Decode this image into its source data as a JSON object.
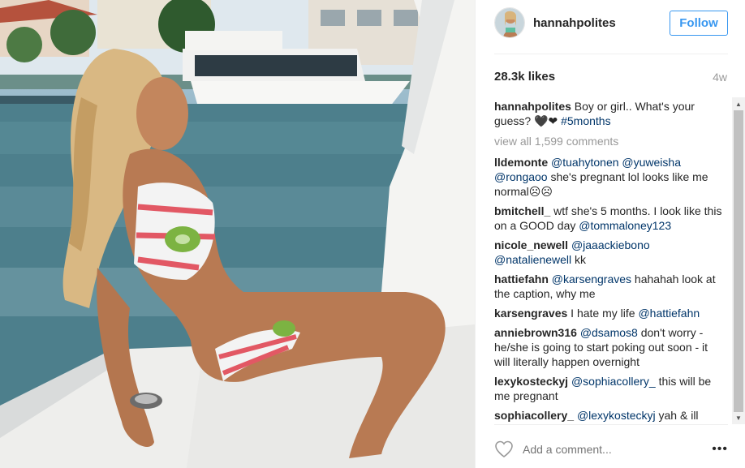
{
  "post": {
    "username": "hannahpolites",
    "follow_label": "Follow",
    "likes": "28.3k likes",
    "age": "4w",
    "view_all": "view all 1,599 comments",
    "add_comment_placeholder": "Add a comment...",
    "more_icon": "•••"
  },
  "caption": {
    "user": "hannahpolites",
    "text": " Boy or girl.. What's your guess? ",
    "emoji": "🖤❤",
    "tag": "#5months"
  },
  "comments": [
    {
      "user": "lldemonte",
      "parts": [
        {
          "t": " ",
          "m": false
        },
        {
          "t": "@tuahytonen",
          "m": true
        },
        {
          "t": " ",
          "m": false
        },
        {
          "t": "@yuweisha",
          "m": true
        },
        {
          "t": " ",
          "m": false
        },
        {
          "t": "@rongaoo",
          "m": true
        },
        {
          "t": " she's pregnant lol looks like me normal☹☹",
          "m": false
        }
      ]
    },
    {
      "user": "bmitchell_",
      "parts": [
        {
          "t": " wtf she's 5 months. I look like this on a GOOD day ",
          "m": false
        },
        {
          "t": "@tommaloney123",
          "m": true
        }
      ]
    },
    {
      "user": "nicole_newell",
      "parts": [
        {
          "t": " ",
          "m": false
        },
        {
          "t": "@jaaackiebono",
          "m": true
        },
        {
          "t": " ",
          "m": false
        },
        {
          "t": "@natalienewell",
          "m": true
        },
        {
          "t": " kk",
          "m": false
        }
      ]
    },
    {
      "user": "hattiefahn",
      "parts": [
        {
          "t": " ",
          "m": false
        },
        {
          "t": "@karsengraves",
          "m": true
        },
        {
          "t": " hahahah look at the caption, why me",
          "m": false
        }
      ]
    },
    {
      "user": "karsengraves",
      "parts": [
        {
          "t": " I hate my life ",
          "m": false
        },
        {
          "t": "@hattiefahn",
          "m": true
        }
      ]
    },
    {
      "user": "anniebrown316",
      "parts": [
        {
          "t": " ",
          "m": false
        },
        {
          "t": "@dsamos8",
          "m": true
        },
        {
          "t": " don't worry - he/she is going to start poking out soon - it will literally happen overnight",
          "m": false
        }
      ]
    },
    {
      "user": "lexykosteckyj",
      "parts": [
        {
          "t": " ",
          "m": false
        },
        {
          "t": "@sophiacollery_",
          "m": true
        },
        {
          "t": " this will be me pregnant",
          "m": false
        }
      ]
    },
    {
      "user": "sophiacollery_",
      "parts": [
        {
          "t": " ",
          "m": false
        },
        {
          "t": "@lexykosteckyj",
          "m": true
        },
        {
          "t": " yah & ill",
          "m": false
        }
      ]
    }
  ],
  "colors": {
    "accent": "#3897f0",
    "mention": "#003569",
    "muted": "#999999"
  },
  "icons": {
    "heart": "heart-icon",
    "more": "more-options-icon"
  }
}
